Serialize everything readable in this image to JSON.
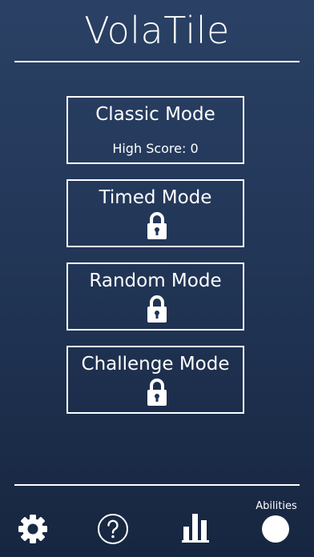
{
  "app": {
    "title": "VolaTile"
  },
  "modes": [
    {
      "label": "Classic Mode",
      "locked": false,
      "high_score_text": "High Score: 0"
    },
    {
      "label": "Timed Mode",
      "locked": true,
      "icon": "lock-icon"
    },
    {
      "label": "Random Mode",
      "locked": true,
      "icon": "lock-icon"
    },
    {
      "label": "Challenge Mode",
      "locked": true,
      "icon": "lock-icon"
    }
  ],
  "bottom_nav": {
    "settings_icon": "gear-icon",
    "help_icon": "question-mark-circle-icon",
    "stats_icon": "bar-chart-icon",
    "abilities_label": "Abilities",
    "abilities_icon": "filled-circle-icon"
  },
  "colors": {
    "background_top": "#2a4165",
    "background_bottom": "#172640",
    "foreground": "#ffffff"
  }
}
